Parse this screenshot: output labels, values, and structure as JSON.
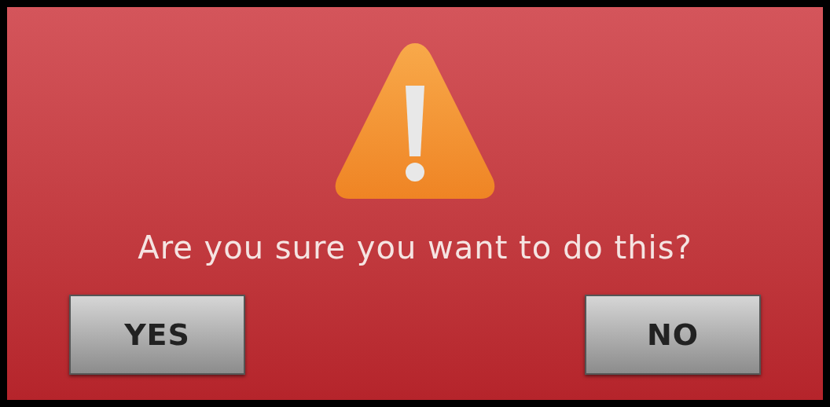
{
  "dialog": {
    "message": "Are you sure you want to do this?",
    "buttons": [
      {
        "label": "YES"
      },
      {
        "label": "NO"
      }
    ]
  }
}
